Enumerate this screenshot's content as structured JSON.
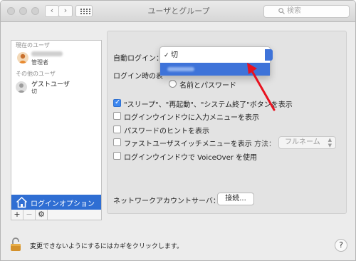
{
  "window": {
    "title": "ユーザとグループ"
  },
  "toolbar": {
    "back_glyph": "‹",
    "forward_glyph": "›",
    "search_placeholder": "検索"
  },
  "sidebar": {
    "current_header": "現在のユーザ",
    "current_user": {
      "name": "",
      "role": "管理者"
    },
    "other_header": "その他のユーザ",
    "guest": {
      "name": "ゲストユーザ",
      "status": "切"
    },
    "login_options": "ログインオプション",
    "tools": {
      "add": "+",
      "remove": "−",
      "gear": "⚙"
    }
  },
  "main": {
    "auto_login": {
      "label": "自動ログイン：",
      "options": [
        "切",
        ""
      ],
      "selected_index": 0
    },
    "login_window_label": "ログイン時の表",
    "radio_name_password": "名前とパスワード",
    "checkboxes": [
      {
        "label": "\"スリープ\"、\"再起動\"、\"システム終了\"ボタンを表示",
        "checked": true
      },
      {
        "label": "ログインウインドウに入力メニューを表示",
        "checked": false
      },
      {
        "label": "パスワードのヒントを表示",
        "checked": false
      },
      {
        "label": "ファストユーザスイッチメニューを表示",
        "checked": false
      },
      {
        "label": "ログインウインドウで VoiceOver を使用",
        "checked": false
      }
    ],
    "method_label": "方法：",
    "method_value": "フルネーム",
    "network_server_label": "ネットワークアカウントサーバ：",
    "connect_button": "接続..."
  },
  "footer": {
    "lock_text": "変更できないようにするにはカギをクリックします。",
    "help": "?"
  },
  "colors": {
    "accent": "#2f6ed3",
    "annotation_arrow": "#e8121f"
  }
}
